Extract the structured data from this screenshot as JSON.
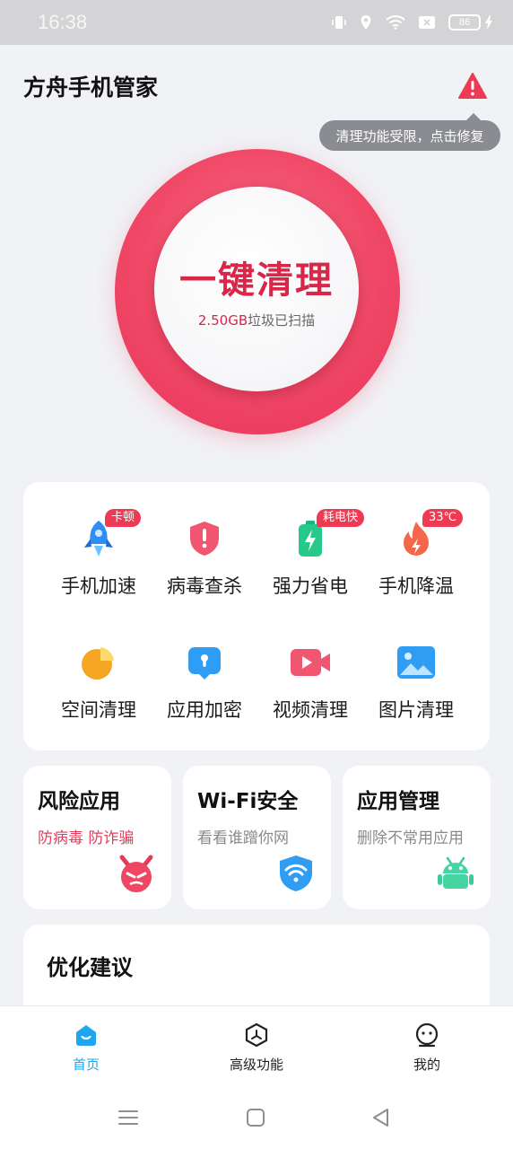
{
  "status_bar": {
    "time": "16:38",
    "battery": "86"
  },
  "header": {
    "title": "方舟手机管家",
    "warning_tooltip": "清理功能受限，点击修复"
  },
  "clean": {
    "button_label": "一键清理",
    "junk_size": "2.50GB",
    "junk_suffix": "垃圾已扫描"
  },
  "tools": [
    {
      "label": "手机加速",
      "icon": "rocket-icon",
      "badge": "卡顿"
    },
    {
      "label": "病毒查杀",
      "icon": "shield-alert-icon",
      "badge": ""
    },
    {
      "label": "强力省电",
      "icon": "battery-icon",
      "badge": "耗电快"
    },
    {
      "label": "手机降温",
      "icon": "flame-icon",
      "badge": "33℃"
    },
    {
      "label": "空间清理",
      "icon": "pie-chart-icon",
      "badge": ""
    },
    {
      "label": "应用加密",
      "icon": "lock-icon",
      "badge": ""
    },
    {
      "label": "视频清理",
      "icon": "video-icon",
      "badge": ""
    },
    {
      "label": "图片清理",
      "icon": "image-icon",
      "badge": ""
    }
  ],
  "features": [
    {
      "title": "风险应用",
      "subtitle": "防病毒 防诈骗",
      "icon": "devil-icon"
    },
    {
      "title": "Wi-Fi安全",
      "subtitle": "看看谁蹭你网",
      "icon": "wifi-shield-icon"
    },
    {
      "title": "应用管理",
      "subtitle": "删除不常用应用",
      "icon": "android-icon"
    }
  ],
  "suggestions": {
    "title": "优化建议"
  },
  "bottom_nav": [
    {
      "label": "首页",
      "icon": "home-icon",
      "active": true
    },
    {
      "label": "高级功能",
      "icon": "hexagon-icon",
      "active": false
    },
    {
      "label": "我的",
      "icon": "profile-icon",
      "active": false
    }
  ],
  "colors": {
    "accent": "#ee3a52",
    "nav_active": "#1ea7f0"
  }
}
